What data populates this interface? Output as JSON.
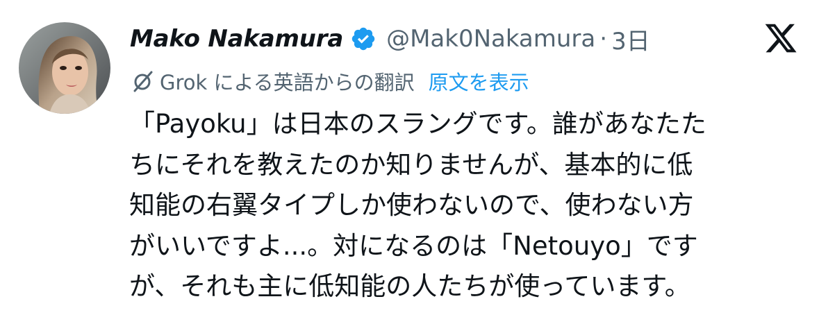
{
  "author": {
    "display_name": "Mako Nakamura",
    "handle": "@Mak0Nakamura",
    "separator": "·",
    "time": "3日",
    "verified_color": "#1d9bf0"
  },
  "translation": {
    "label": "Grok による英語からの翻訳",
    "show_original": "原文を表示"
  },
  "tweet": {
    "lines": [
      "「Payoku」は日本のスラングです。誰があなたた",
      "ちにそれを教えたのか知りませんが、基本的に低",
      "知能の右翼タイプしか使わないので、使わない方",
      "がいいですよ...。対になるのは「Netouyo」です",
      "が、それも主に低知能の人たちが使っています。"
    ]
  },
  "icons": {
    "avatar": "avatar",
    "verified": "verified-badge-icon",
    "platform": "x-logo-icon",
    "translate": "translate-icon"
  },
  "colors": {
    "text": "#0f1419",
    "secondary": "#536471",
    "link": "#1d9bf0"
  }
}
